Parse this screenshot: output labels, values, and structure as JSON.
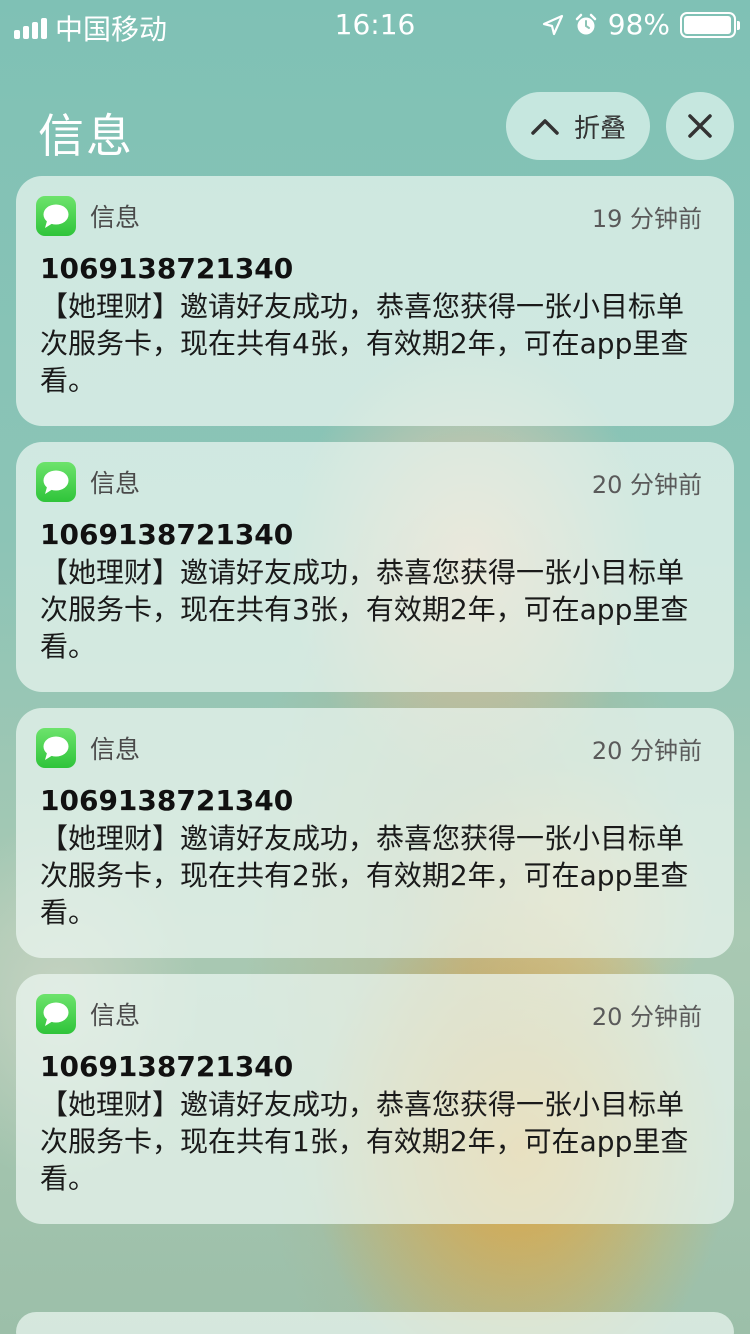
{
  "status_bar": {
    "carrier": "中国移动",
    "time": "16:16",
    "battery_percent": "98%",
    "battery_level": 0.98,
    "icons": [
      "signal-icon",
      "location-icon",
      "alarm-icon",
      "battery-icon"
    ]
  },
  "header": {
    "title": "信息",
    "collapse_label": "折叠",
    "collapse_icon": "chevron-up-icon",
    "close_icon": "close-icon"
  },
  "notifications": [
    {
      "app_name": "信息",
      "time": "19 分钟前",
      "sender": "1069138721340",
      "body": "【她理财】邀请好友成功，恭喜您获得一张小目标单次服务卡，现在共有4张，有效期2年，可在app里查看。"
    },
    {
      "app_name": "信息",
      "time": "20 分钟前",
      "sender": "1069138721340",
      "body": "【她理财】邀请好友成功，恭喜您获得一张小目标单次服务卡，现在共有3张，有效期2年，可在app里查看。"
    },
    {
      "app_name": "信息",
      "time": "20 分钟前",
      "sender": "1069138721340",
      "body": "【她理财】邀请好友成功，恭喜您获得一张小目标单次服务卡，现在共有2张，有效期2年，可在app里查看。"
    },
    {
      "app_name": "信息",
      "time": "20 分钟前",
      "sender": "1069138721340",
      "body": "【她理财】邀请好友成功，恭喜您获得一张小目标单次服务卡，现在共有1张，有效期2年，可在app里查看。"
    }
  ],
  "colors": {
    "messages_green": "#34c759",
    "card_background": "#ecf6f1"
  }
}
